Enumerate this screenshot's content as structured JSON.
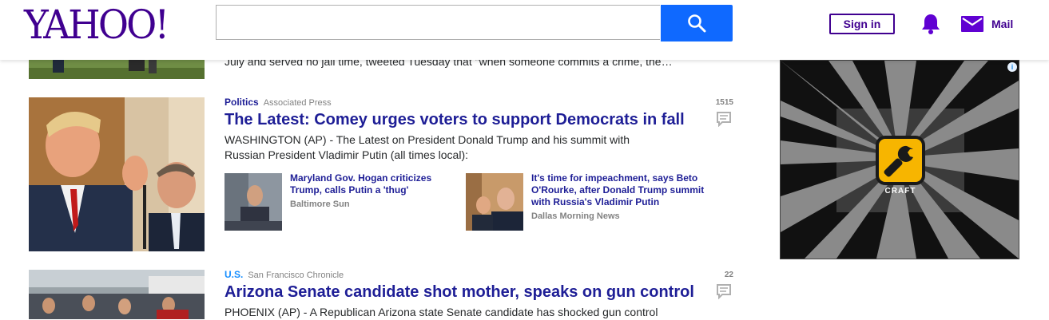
{
  "header": {
    "logo": "YAHOO!",
    "search_value": "",
    "signin_label": "Sign in",
    "mail_label": "Mail"
  },
  "stream": {
    "prev_summary_tail": "July and served no jail time, tweeted Tuesday that \"when someone commits a crime, the…",
    "items": [
      {
        "category": "Politics",
        "provider": "Associated Press",
        "headline": "The Latest: Comey urges voters to support Democrats in fall",
        "summary": "WASHINGTON (AP) - The Latest on President Donald Trump and his summit with Russian President Vladimir Putin (all times local):",
        "comment_count": "1515",
        "related": [
          {
            "title": "Maryland Gov. Hogan criticizes Trump, calls Putin a 'thug'",
            "provider": "Baltimore Sun"
          },
          {
            "title": "It's time for impeachment, says Beto O'Rourke, after Donald Trump summit with Russia's Vladimir Putin",
            "provider": "Dallas Morning News"
          }
        ]
      },
      {
        "category": "U.S.",
        "provider": "San Francisco Chronicle",
        "headline": "Arizona Senate candidate shot mother, speaks on gun control",
        "summary": "PHOENIX (AP) - A Republican Arizona state Senate candidate has shocked gun control",
        "comment_count": "22"
      }
    ]
  },
  "ad": {
    "brand": "CRAFT"
  },
  "colors": {
    "brand_purple": "#400090",
    "search_blue": "#0f69ff",
    "politics_blue": "#1e1e96",
    "us_blue": "#188fff",
    "headline_blue": "#1e1e96"
  },
  "icons": [
    "search-icon",
    "bell-icon",
    "mail-icon",
    "comment-icon",
    "ad-info-icon",
    "wrench-icon"
  ]
}
